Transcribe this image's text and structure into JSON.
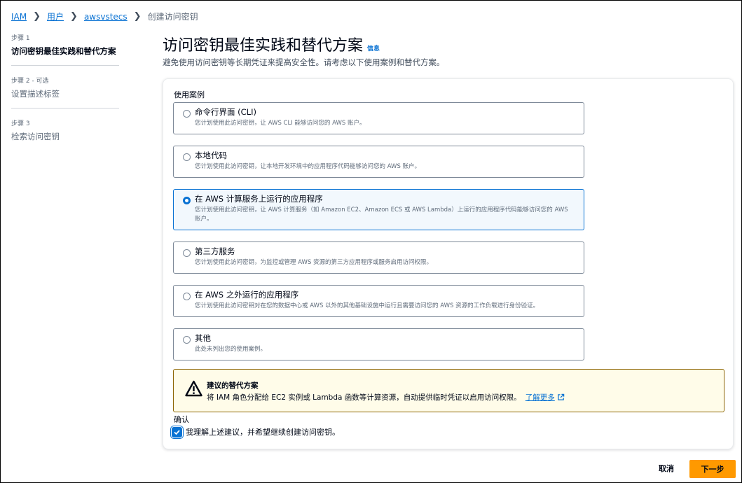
{
  "breadcrumb": {
    "items": [
      "IAM",
      "用户",
      "awsvstecs"
    ],
    "current": "创建访问密钥"
  },
  "steps": [
    {
      "num": "步骤 1",
      "title": "访问密钥最佳实践和替代方案"
    },
    {
      "num": "步骤 2 - 可选",
      "title": "设置描述标签"
    },
    {
      "num": "步骤 3",
      "title": "检索访问密钥"
    }
  ],
  "header": {
    "title": "访问密钥最佳实践和替代方案",
    "info": "信息",
    "description": "避免使用访问密钥等长期凭证来提高安全性。请考虑以下使用案例和替代方案。"
  },
  "use_cases": {
    "label": "使用案例",
    "selected_index": 2,
    "options": [
      {
        "title": "命令行界面 (CLI)",
        "desc": "您计划使用此访问密钥，让 AWS CLI 能够访问您的 AWS 账户。"
      },
      {
        "title": "本地代码",
        "desc": "您计划使用此访问密钥，让本地开发环境中的应用程序代码能够访问您的 AWS 账户。"
      },
      {
        "title": "在 AWS 计算服务上运行的应用程序",
        "desc": "您计划使用此访问密钥，让 AWS 计算服务（如 Amazon EC2、Amazon ECS 或 AWS Lambda）上运行的应用程序代码能够访问您的 AWS 账户。"
      },
      {
        "title": "第三方服务",
        "desc": "您计划使用此访问密钥，为监控或管理 AWS 资源的第三方应用程序或服务启用访问权限。"
      },
      {
        "title": "在 AWS 之外运行的应用程序",
        "desc": "您计划使用此访问密钥对在您的数据中心或 AWS 以外的其他基础设施中运行且需要访问您的 AWS 资源的工作负载进行身份验证。"
      },
      {
        "title": "其他",
        "desc": "此处未列出您的使用案例。"
      }
    ]
  },
  "alert": {
    "icon": "warning-icon",
    "title": "建议的替代方案",
    "body": "将 IAM 角色分配给 EC2 实例或 Lambda 函数等计算资源，自动提供临时凭证以启用访问权限。",
    "link": "了解更多"
  },
  "confirm": {
    "label": "确认",
    "text": "我理解上述建议，并希望继续创建访问密钥。",
    "checked": true
  },
  "footer": {
    "cancel": "取消",
    "next": "下一步"
  },
  "colors": {
    "link": "#0972d3",
    "primary_button": "#ff9900",
    "alert_border": "#8d6605",
    "alert_bg": "#fffce9"
  }
}
